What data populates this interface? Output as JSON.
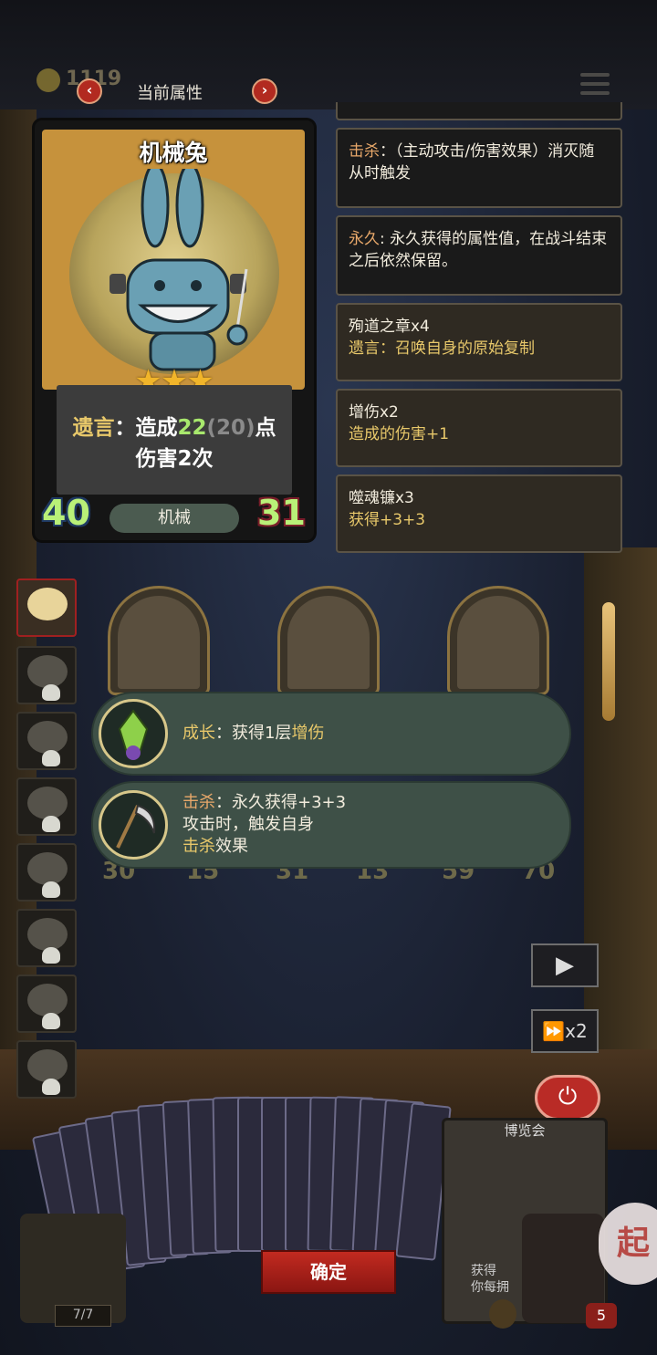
{
  "top_bar": {
    "coins": "1119"
  },
  "header": {
    "title": "当前属性",
    "prev": "‹",
    "next": "›"
  },
  "hero_card": {
    "name": "机械兔",
    "stars": "★★★",
    "desc_keyword": "遗言",
    "desc_part1": "：造成",
    "damage_value": "22",
    "damage_base": "(20)",
    "desc_part2": "点",
    "desc_line2": "伤害2次",
    "attack": "40",
    "health": "31",
    "tribe": "机械"
  },
  "keyword_panels": [
    {
      "keyword": "击杀",
      "text": "：（主动攻击/伤害效果）消灭随从时触发"
    },
    {
      "keyword": "永久",
      "text": ": 永久获得的属性值，在战斗结束之后依然保留。"
    }
  ],
  "buff_panels": [
    {
      "name": "殉道之章x4",
      "effect": "遗言：召唤自身的原始复制"
    },
    {
      "name": "增伤x2",
      "effect": "造成的伤害+1"
    },
    {
      "name": "噬魂镰x3",
      "effect": "获得+3+3"
    }
  ],
  "effects": [
    {
      "keyword": "成长",
      "sep": "：获得1层",
      "keyword2": "增伤"
    },
    {
      "keyword": "击杀",
      "line1": "：永久获得+3+3",
      "line2": "攻击时，触发自身",
      "keyword3": "击杀",
      "line3_tail": "效果"
    }
  ],
  "board": {
    "minions": [
      {
        "attack": "30",
        "health": "15"
      },
      {
        "attack": "31",
        "health": "13"
      },
      {
        "attack": "59",
        "health": "70"
      }
    ]
  },
  "controls": {
    "play": "▶",
    "speed": "x2",
    "speed_icon": "⏩",
    "power": "⏻"
  },
  "bottom": {
    "confirm_label": "确定",
    "deck_counter": "7/7",
    "shop_card_title": "博览会",
    "shop_card_text": "获得\n你每拥",
    "avatar_count": "5",
    "side_label": "起"
  },
  "colors": {
    "keyword_orange": "#e8a86a",
    "keyword_gold": "#e8c86a",
    "stat_green": "#b9f078",
    "confirm_red": "#c22a20"
  }
}
